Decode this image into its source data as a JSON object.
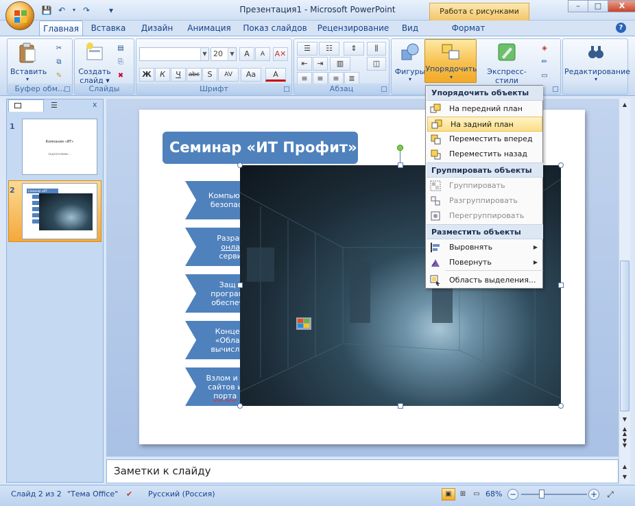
{
  "window": {
    "title": "Презентация1 - Microsoft PowerPoint",
    "context_tab": "Работа с рисунками",
    "minimize": "–",
    "maximize": "□",
    "close": "X"
  },
  "qat": {
    "save": "💾",
    "undo": "↶",
    "redo": "↷",
    "customize": "▾"
  },
  "tabs": [
    "Главная",
    "Вставка",
    "Дизайн",
    "Анимация",
    "Показ слайдов",
    "Рецензирование",
    "Вид",
    "Формат"
  ],
  "help_icon": "?",
  "ribbon": {
    "clipboard": {
      "label": "Буфер обм...",
      "paste": "Вставить"
    },
    "slides": {
      "label": "Слайды",
      "new_slide_line1": "Создать",
      "new_slide_line2": "слайд ▾"
    },
    "font": {
      "label": "Шрифт",
      "font_name": "",
      "font_size": "20",
      "grow": "A",
      "shrink": "A",
      "bold": "Ж",
      "italic": "К",
      "underline": "Ч",
      "strike": "abc",
      "shadow": "S",
      "spacing": "AV",
      "case": "Aa",
      "color": "A"
    },
    "paragraph": {
      "label": "Абзац"
    },
    "drawing": {
      "shapes": "Фигуры",
      "arrange": "Упорядочить",
      "quick_styles": "Экспресс-стили"
    },
    "editing": {
      "label": "Редактирование"
    }
  },
  "panel": {
    "close": "x",
    "slides": [
      {
        "num": "1",
        "title": "Компания «ИТ»",
        "subtitle": "подзаголовок…"
      },
      {
        "num": "2",
        "title": "Семинар «ИТ Профит»"
      }
    ]
  },
  "slide": {
    "title": "Семинар «ИТ Профит»",
    "items": [
      {
        "line1": "Компьют",
        "line2": "безопас"
      },
      {
        "line1": "Разраб",
        "line2": "онла",
        "line3": "серви"
      },
      {
        "line1": "Защ",
        "line2": "програм",
        "line3": "обеспеч"
      },
      {
        "line1": "Конце",
        "line2": "«Обла",
        "line3": "вычисле"
      },
      {
        "line1": "Взлом и з",
        "line2": "сайтов и",
        "line3": "порта"
      }
    ]
  },
  "menu": {
    "sections": [
      {
        "header": "Упорядочить объекты",
        "items": [
          {
            "label": "На передний план",
            "icon": "bring-front-icon"
          },
          {
            "label": "На задний план",
            "icon": "send-back-icon",
            "highlighted": true
          },
          {
            "label": "Переместить вперед",
            "icon": "bring-forward-icon"
          },
          {
            "label": "Переместить назад",
            "icon": "send-backward-icon"
          }
        ]
      },
      {
        "header": "Группировать объекты",
        "items": [
          {
            "label": "Группировать",
            "icon": "group-icon",
            "disabled": true
          },
          {
            "label": "Разгруппировать",
            "icon": "ungroup-icon",
            "disabled": true
          },
          {
            "label": "Перегруппировать",
            "icon": "regroup-icon",
            "disabled": true
          }
        ]
      },
      {
        "header": "Разместить объекты",
        "items": [
          {
            "label": "Выровнять",
            "icon": "align-icon",
            "submenu": true
          },
          {
            "label": "Повернуть",
            "icon": "rotate-icon",
            "submenu": true
          },
          {
            "label": "Область выделения...",
            "icon": "selection-pane-icon"
          }
        ]
      }
    ],
    "submenu_arrow": "▶"
  },
  "notes": {
    "placeholder": "Заметки к слайду"
  },
  "status": {
    "slide": "Слайд 2 из 2",
    "theme": "\"Тема Office\"",
    "lang": "Русский (Россия)",
    "zoom": "68%",
    "zoom_out": "−",
    "zoom_in": "+"
  },
  "colors": {
    "accent": "#4f81bd",
    "ribbon": "#dbe7f6",
    "highlight": "#fbdf84"
  }
}
